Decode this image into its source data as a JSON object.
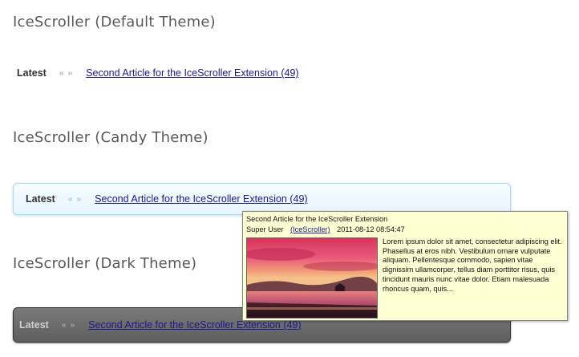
{
  "sections": [
    {
      "title": "IceScroller (Default Theme)"
    },
    {
      "title": "IceScroller (Candy Theme)"
    },
    {
      "title": "IceScroller (Dark Theme)"
    }
  ],
  "scroller": {
    "label": "Latest",
    "prev_glyph": "‹‹",
    "next_glyph": "››",
    "prev_icon": "double-chevron-left-icon",
    "next_icon": "double-chevron-right-icon",
    "article_link": "Second Article for the IceScroller Extension (49)"
  },
  "tooltip": {
    "title": "Second Article for the IceScroller Extension",
    "author": "Super User",
    "category": "(IceScroller)",
    "date": "2011-08-12 08:54:47",
    "body": "Lorem ipsum dolor sit amet, consectetur adipiscing elit. Phasellus at eros nibh. Vestibulum ornare vulputate aliquam. Pellentesque commodo, sapien vitae dignissim ullamcorper, tellus diam porttitor risus, quis tincidunt mauris nunc vitae dolor. Etiam malesuada rhoncus quam, quis..."
  },
  "colors": {
    "candy_border": "#a9d9f4",
    "dark_background": "#6b6b6b",
    "tooltip_background": "#ffffd4",
    "link": "#1a1a8c"
  }
}
